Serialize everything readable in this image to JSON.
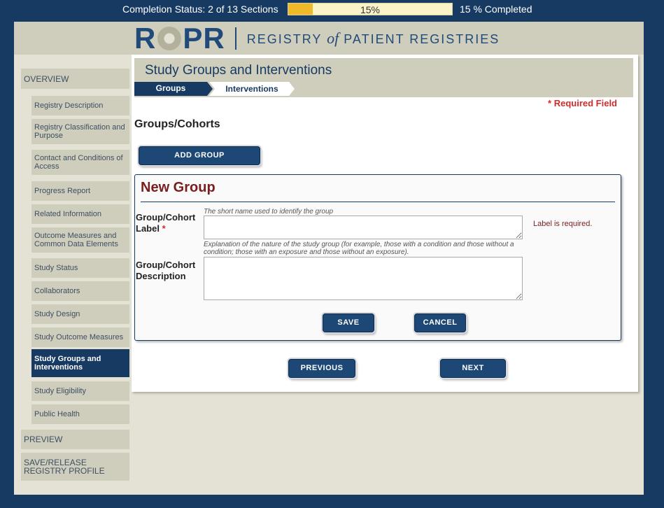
{
  "status": {
    "completion_label": "Completion Status: 2 of 13 Sections",
    "progress_percent": 15,
    "progress_text": "15%",
    "completed_label": "15 % Completed",
    "fill_color": "#f0b929"
  },
  "logo": {
    "brand_r": "R",
    "brand_pr": "PR",
    "tagline_prefix": "REGISTRY",
    "tagline_of": "of",
    "tagline_suffix": "PATIENT REGISTRIES"
  },
  "sidebar": {
    "overview": "OVERVIEW",
    "items": [
      {
        "label": "Registry Description"
      },
      {
        "label": "Registry Classification and Purpose"
      },
      {
        "label": "Contact and Conditions of Access"
      },
      {
        "label": "Progress Report"
      },
      {
        "label": "Related Information"
      },
      {
        "label": "Outcome Measures and Common Data Elements"
      },
      {
        "label": "Study Status"
      },
      {
        "label": "Collaborators"
      },
      {
        "label": "Study Design"
      },
      {
        "label": "Study Outcome Measures"
      },
      {
        "label": "Study Groups and Interventions"
      },
      {
        "label": "Study Eligibility"
      },
      {
        "label": "Public Health"
      }
    ],
    "preview": "PREVIEW",
    "save_release": "SAVE/RELEASE REGISTRY PROFILE"
  },
  "main": {
    "title": "Study Groups and Interventions",
    "tabs": [
      {
        "label": "Groups"
      },
      {
        "label": "Interventions"
      }
    ],
    "required_star": "*",
    "required_text": "Required Field",
    "section_heading": "Groups/Cohorts",
    "add_group_button": "ADD GROUP",
    "new_group": {
      "title": "New Group",
      "label_field": {
        "hint": "The short name used to identify the group",
        "label": "Group/Cohort Label",
        "required_star": "*",
        "value": "",
        "error": "Label is required."
      },
      "description_field": {
        "hint": "Explanation of the nature of the study group (for example, those with a condition and those without a condition; those with an exposure and those without an exposure).",
        "label": "Group/Cohort Description",
        "value": ""
      },
      "save_button": "SAVE",
      "cancel_button": "CANCEL"
    },
    "previous_button": "PREVIOUS",
    "next_button": "NEXT"
  },
  "colors": {
    "navy": "#173a63",
    "panel_gray": "#cfcebd",
    "required_red": "#d32b2b",
    "heading_maroon": "#7a1d1d"
  }
}
